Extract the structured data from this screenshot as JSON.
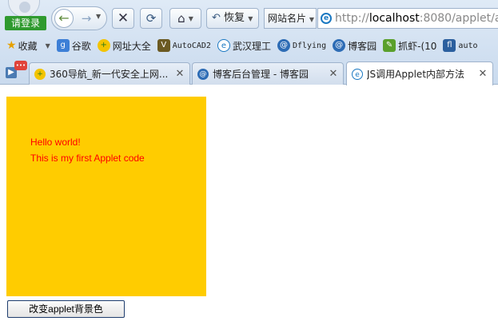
{
  "colors": {
    "applet_bg": "#ffcc00",
    "applet_text": "#ff0000"
  },
  "toolbar": {
    "login_label": "请登录",
    "restore_label": "恢复",
    "site_card_label": "网站名片",
    "url_host": "localhost",
    "url_prefix": "http://",
    "url_rest": ":8080/applet/ap"
  },
  "bookmarks": [
    {
      "label": "收藏",
      "icon": "star-icon"
    },
    {
      "label": "谷歌",
      "icon": "google-icon"
    },
    {
      "label": "网址大全",
      "icon": "360-icon"
    },
    {
      "label": "AutoCAD2",
      "icon": "autocad-icon"
    },
    {
      "label": "武汉理工",
      "icon": "ie-icon"
    },
    {
      "label": "Dflying",
      "icon": "cnblogs-icon"
    },
    {
      "label": "博客园",
      "icon": "cnblogs-icon"
    },
    {
      "label": "抓虾-(10",
      "icon": "zhuaxia-icon"
    },
    {
      "label": "auto",
      "icon": "auto-icon"
    }
  ],
  "tabs": [
    {
      "title": "360导航_新一代安全上网...",
      "icon": "360-icon"
    },
    {
      "title": "博客后台管理 - 博客园",
      "icon": "cnblogs-icon"
    },
    {
      "title": "JS调用Applet内部方法",
      "icon": "ie-icon"
    }
  ],
  "applet": {
    "line1": "Hello world!",
    "line2": "This is my first Applet code"
  },
  "change_button_label": "改变applet背景色"
}
